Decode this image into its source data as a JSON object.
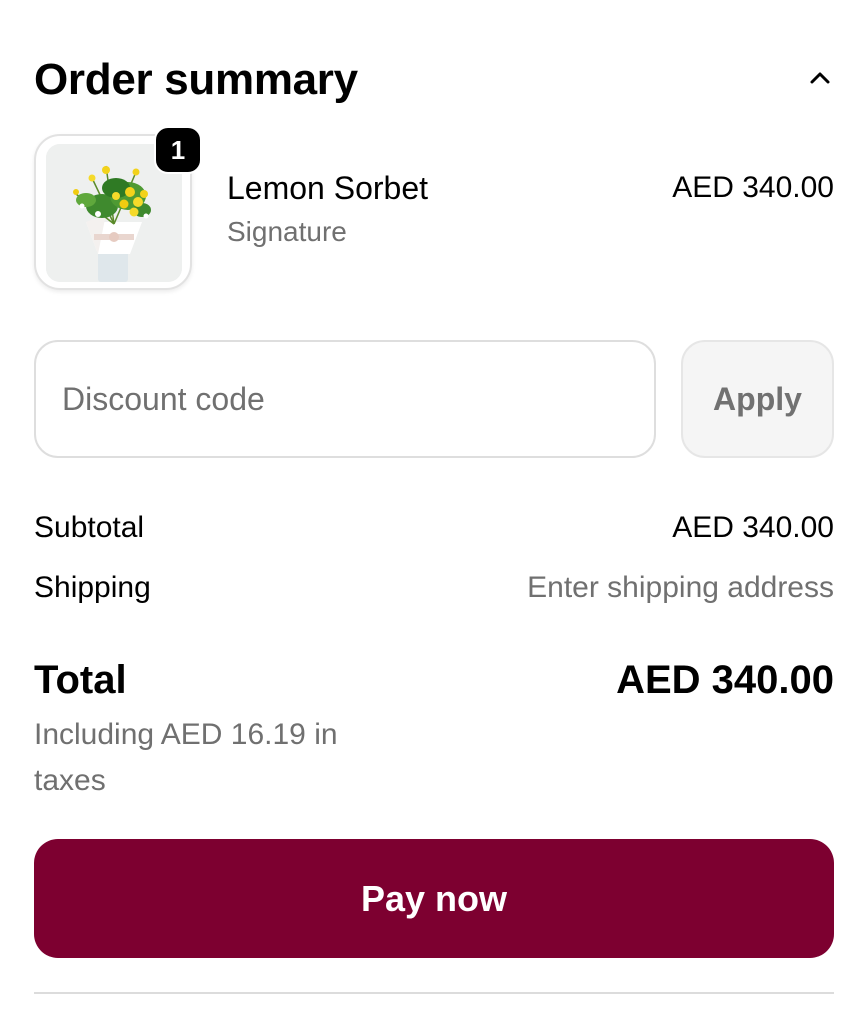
{
  "header": {
    "title": "Order summary",
    "toggle_icon": "chevron-up-icon"
  },
  "line_item": {
    "quantity": "1",
    "name": "Lemon Sorbet",
    "variant": "Signature",
    "price": "AED 340.00"
  },
  "discount": {
    "placeholder": "Discount code",
    "value": "",
    "apply_label": "Apply"
  },
  "summary": {
    "subtotal_label": "Subtotal",
    "subtotal_value": "AED 340.00",
    "shipping_label": "Shipping",
    "shipping_value": "Enter shipping address",
    "total_label": "Total",
    "total_value": "AED 340.00",
    "tax_note": "Including AED 16.19 in taxes"
  },
  "actions": {
    "pay_label": "Pay now"
  },
  "colors": {
    "primary": "#7d0030",
    "muted_text": "#707070",
    "border": "#dedede",
    "button_disabled_bg": "#f5f5f5"
  }
}
